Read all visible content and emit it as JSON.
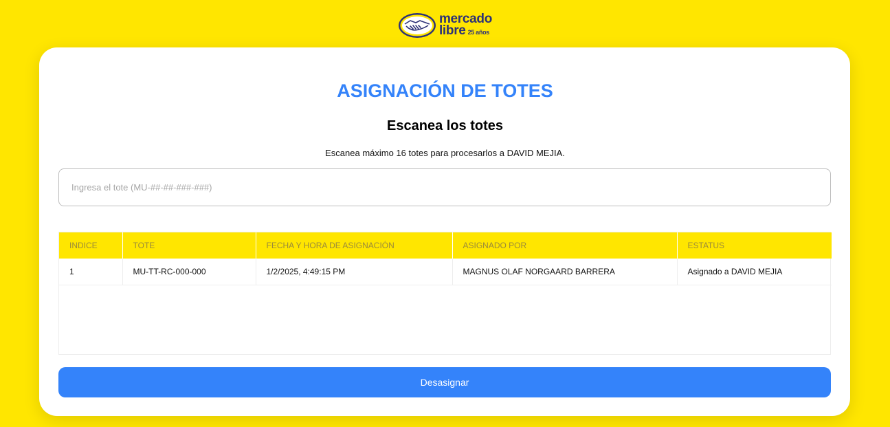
{
  "brand": {
    "line1": "mercado",
    "line2": "libre",
    "years": "25 años",
    "colors": {
      "yellow": "#FFE600",
      "navy": "#2D3277",
      "blue": "#3483FA"
    },
    "icon": "handshake-icon"
  },
  "page": {
    "title": "ASIGNACIÓN DE TOTES",
    "subtitle": "Escanea los totes",
    "instructions": "Escanea máximo 16 totes para procesarlos a DAVID MEJIA."
  },
  "input": {
    "value": "",
    "placeholder": "Ingresa el tote (MU-##-##-###-###)"
  },
  "table": {
    "columns": [
      "INDICE",
      "TOTE",
      "FECHA Y HORA DE ASIGNACIÓN",
      "ASIGNADO POR",
      "ESTATUS"
    ],
    "rows": [
      [
        "1",
        "MU-TT-RC-000-000",
        "1/2/2025, 4:49:15 PM",
        "MAGNUS OLAF NORGAARD BARRERA",
        "Asignado a DAVID MEJIA"
      ]
    ]
  },
  "actions": {
    "unassign_label": "Desasignar"
  }
}
